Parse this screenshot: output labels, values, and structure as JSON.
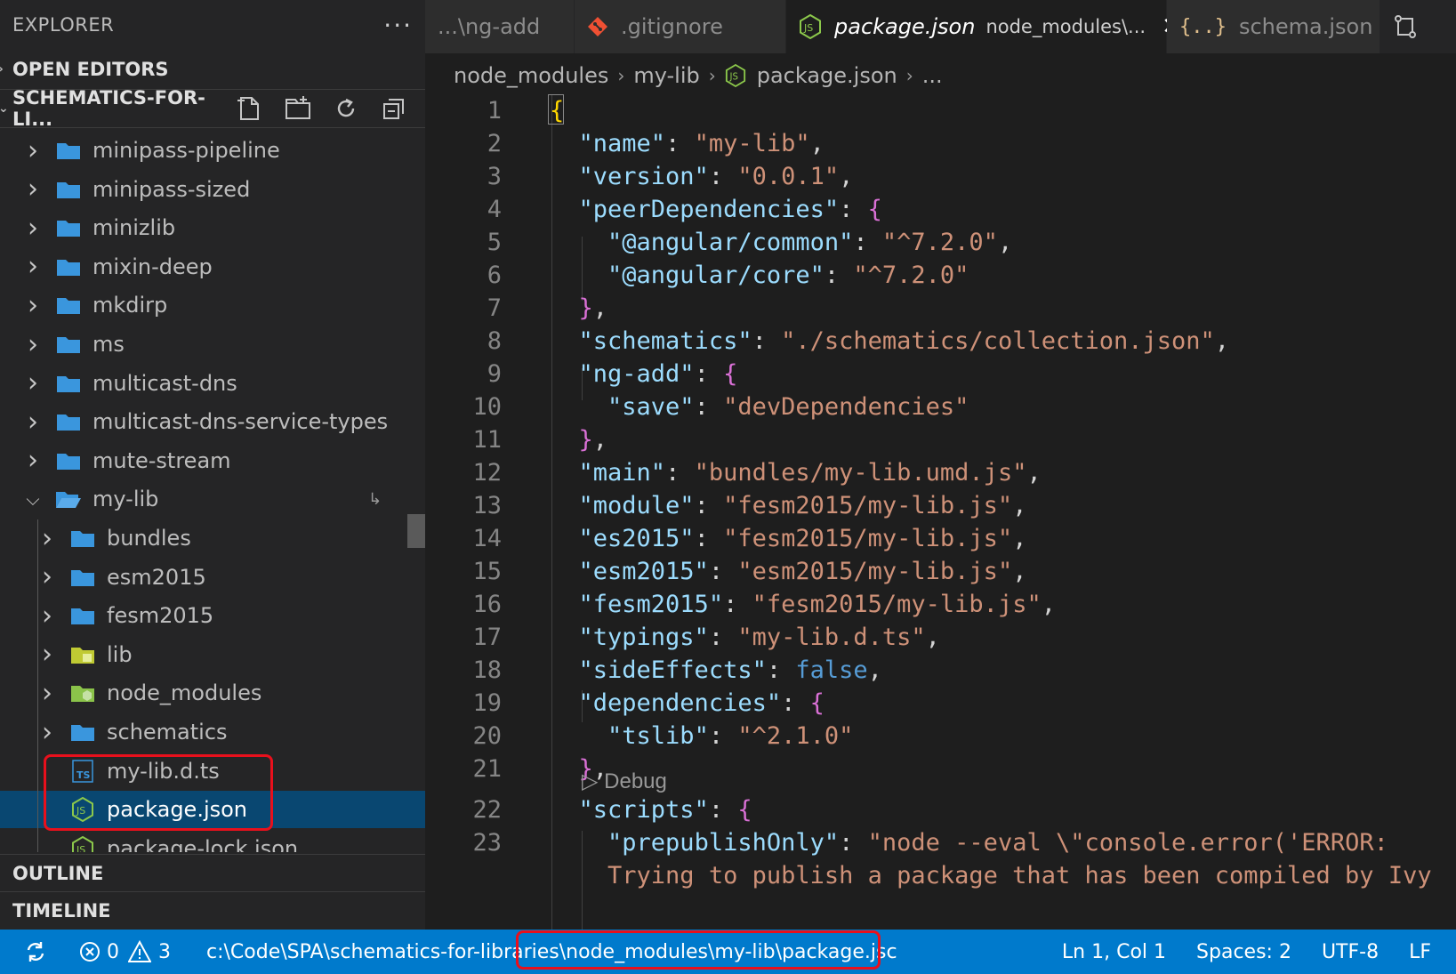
{
  "sidebar": {
    "title": "EXPLORER",
    "more": "···",
    "open_editors": "OPEN EDITORS",
    "project": "SCHEMATICS-FOR-LI...",
    "outline": "OUTLINE",
    "timeline": "TIMELINE",
    "tree": [
      {
        "label": "minipass-pipeline",
        "type": "folder",
        "depth": 0,
        "expanded": false
      },
      {
        "label": "minipass-sized",
        "type": "folder",
        "depth": 0,
        "expanded": false
      },
      {
        "label": "minizlib",
        "type": "folder",
        "depth": 0,
        "expanded": false
      },
      {
        "label": "mixin-deep",
        "type": "folder",
        "depth": 0,
        "expanded": false
      },
      {
        "label": "mkdirp",
        "type": "folder",
        "depth": 0,
        "expanded": false
      },
      {
        "label": "ms",
        "type": "folder",
        "depth": 0,
        "expanded": false
      },
      {
        "label": "multicast-dns",
        "type": "folder",
        "depth": 0,
        "expanded": false
      },
      {
        "label": "multicast-dns-service-types",
        "type": "folder",
        "depth": 0,
        "expanded": false
      },
      {
        "label": "mute-stream",
        "type": "folder",
        "depth": 0,
        "expanded": false
      },
      {
        "label": "my-lib",
        "type": "folder-open",
        "depth": 0,
        "expanded": true
      },
      {
        "label": "bundles",
        "type": "folder",
        "depth": 1,
        "expanded": false
      },
      {
        "label": "esm2015",
        "type": "folder",
        "depth": 1,
        "expanded": false
      },
      {
        "label": "fesm2015",
        "type": "folder",
        "depth": 1,
        "expanded": false
      },
      {
        "label": "lib",
        "type": "folder-lib",
        "depth": 1,
        "expanded": false
      },
      {
        "label": "node_modules",
        "type": "folder-node",
        "depth": 1,
        "expanded": false
      },
      {
        "label": "schematics",
        "type": "folder",
        "depth": 1,
        "expanded": false
      },
      {
        "label": "my-lib.d.ts",
        "type": "ts-file",
        "depth": 1
      },
      {
        "label": "package.json",
        "type": "json-file",
        "depth": 1,
        "selected": true
      },
      {
        "label": "package-lock.json",
        "type": "json-file",
        "depth": 1
      }
    ]
  },
  "tabs": [
    {
      "label": "...\\ng-add",
      "icon": "none"
    },
    {
      "label": ".gitignore",
      "icon": "git-icon"
    },
    {
      "label": "package.json",
      "desc": "node_modules\\...",
      "icon": "nodejs-icon",
      "active": true
    },
    {
      "label": "schema.json",
      "icon": "json-braces-icon"
    }
  ],
  "breadcrumb": [
    "node_modules",
    "my-lib",
    "package.json",
    "..."
  ],
  "editor": {
    "codelens": "Debug",
    "codelens_icon": "▷"
  },
  "status": {
    "errors": "0",
    "warnings": "3",
    "path": "c:\\Code\\SPA\\schematics-for-libraries\\node_modules\\my-lib\\package.jsc",
    "position": "Ln 1, Col 1",
    "spaces": "Spaces: 2",
    "encoding": "UTF-8",
    "eol": "LF"
  },
  "colors": {
    "accent": "#007acc",
    "selection": "#094771",
    "highlight": "#e8101c",
    "folder": "#3a96dd"
  }
}
